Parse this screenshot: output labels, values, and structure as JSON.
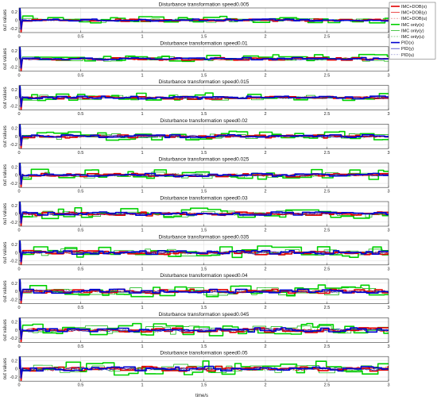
{
  "chart_data": {
    "type": "line",
    "layout": "10 stacked line subplots sharing the x axis",
    "grid": true,
    "legend_placement": "top-right, outside the plot area",
    "xlabel": "time/s",
    "ylabel": "out values",
    "xlim": [
      0,
      3
    ],
    "ylim": [
      -0.3,
      0.3
    ],
    "xticks": [
      0,
      0.5,
      1,
      1.5,
      2,
      2.5,
      3
    ],
    "xtick_labels": [
      "0",
      "0.5",
      "1",
      "1.5",
      "2",
      "2.5",
      "3"
    ],
    "yticks": [
      -0.2,
      0,
      0.2
    ],
    "ytick_labels": [
      "-0.2",
      "0",
      "0.2"
    ],
    "legend": [
      {
        "label": "IMC+DOB(x)",
        "color": "#e00000",
        "style": "solid",
        "width": 1.6
      },
      {
        "label": "IMC+DOB(y)",
        "color": "#e00000",
        "style": "solid",
        "width": 0.7
      },
      {
        "label": "IMC+DOB(u)",
        "color": "#e07070",
        "style": "dashed",
        "width": 0.7
      },
      {
        "label": "IMC only(x)",
        "color": "#00d000",
        "style": "solid",
        "width": 1.6
      },
      {
        "label": "IMC only(y)",
        "color": "#00b000",
        "style": "solid",
        "width": 0.7
      },
      {
        "label": "IMC only(u)",
        "color": "#70c070",
        "style": "dashed",
        "width": 0.7
      },
      {
        "label": "PID(x)",
        "color": "#0000d0",
        "style": "solid",
        "width": 1.6
      },
      {
        "label": "PID(y)",
        "color": "#2020c0",
        "style": "solid",
        "width": 0.7
      },
      {
        "label": "PID(u)",
        "color": "#8888cc",
        "style": "dashed",
        "width": 0.7
      }
    ],
    "panels": [
      {
        "title": "Disturbance transformation speed0.005",
        "speed": 0.005
      },
      {
        "title": "Disturbance transformation speed0.01",
        "speed": 0.01
      },
      {
        "title": "Disturbance transformation speed0.015",
        "speed": 0.015
      },
      {
        "title": "Disturbance transformation speed0.02",
        "speed": 0.02
      },
      {
        "title": "Disturbance transformation speed0.025",
        "speed": 0.025
      },
      {
        "title": "Disturbance transformation speed0.03",
        "speed": 0.03
      },
      {
        "title": "Disturbance transformation speed0.035",
        "speed": 0.035
      },
      {
        "title": "Disturbance transformation speed0.04",
        "speed": 0.04
      },
      {
        "title": "Disturbance transformation speed0.045",
        "speed": 0.045
      },
      {
        "title": "Disturbance transformation speed0.05",
        "speed": 0.05
      }
    ],
    "series_note": "Each panel shows the nine signals above: after an initial transient near t=0 the IMC+DOB and PID outputs stay close to 0 (about ±0.05); the IMC-only output (green) deviates most, reaching roughly -0.15 to 0.2, with larger deviations at faster disturbance speeds."
  }
}
